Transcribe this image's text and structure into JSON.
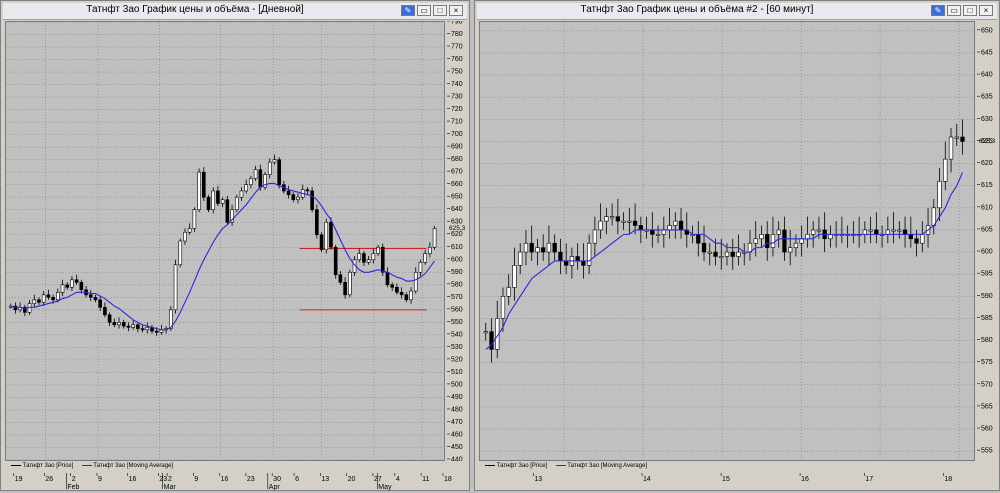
{
  "left_window": {
    "title": "Татнфт 3ао График цены и объёма - [Дневной]",
    "y_ticks": [
      "790",
      "780",
      "770",
      "760",
      "750",
      "740",
      "730",
      "720",
      "710",
      "700",
      "690",
      "680",
      "670",
      "660",
      "650",
      "640",
      "630",
      "620",
      "610",
      "600",
      "590",
      "580",
      "570",
      "560",
      "550",
      "540",
      "530",
      "520",
      "510",
      "500",
      "490",
      "480",
      "470",
      "460",
      "450",
      "440"
    ],
    "last_price_label": "625,3",
    "x_ticks": [
      "19",
      "26",
      "2",
      "9",
      "16",
      "23",
      "2",
      "9",
      "16",
      "23",
      "30",
      "6",
      "13",
      "20",
      "27",
      "4",
      "11",
      "18"
    ],
    "months": [
      "Feb",
      "Mar",
      "Apr",
      "May"
    ],
    "legend_price": "Татнфт 3ао [Price]",
    "legend_ma": "Татнфт 3ао [Moving Average]"
  },
  "right_window": {
    "title": "Татнфт 3ао График цены и объёма #2 - [60 минут]",
    "y_ticks": [
      "650",
      "645",
      "640",
      "635",
      "630",
      "625",
      "620",
      "615",
      "610",
      "605",
      "600",
      "595",
      "590",
      "585",
      "580",
      "575",
      "570",
      "565",
      "560",
      "555"
    ],
    "last_price_label": "625,3",
    "x_ticks": [
      "13",
      "14",
      "15",
      "16",
      "17",
      "18"
    ],
    "legend_price": "Татнфт 3ао [Price]",
    "legend_ma": "Татнфт 3ао [Moving Average]"
  },
  "colors": {
    "candle_up": "#ffffff",
    "candle_down": "#000000",
    "moving_average": "#2a2ad8",
    "level_line": "#d22020",
    "grid": "#808080"
  },
  "chart_data": [
    {
      "type": "candlestick",
      "title": "Татнфт 3ао График цены и объёма - [Дневной]",
      "ylim": [
        440,
        790
      ],
      "series": [
        {
          "name": "Татнфт 3ао [Price]",
          "close": [
            563,
            560,
            562,
            558,
            565,
            568,
            566,
            572,
            570,
            568,
            574,
            580,
            578,
            584,
            582,
            576,
            572,
            570,
            568,
            562,
            556,
            550,
            548,
            550,
            547,
            546,
            548,
            545,
            544,
            546,
            543,
            542,
            544,
            545,
            560,
            596,
            615,
            622,
            625,
            640,
            670,
            650,
            640,
            655,
            645,
            648,
            630,
            640,
            650,
            655,
            660,
            665,
            672,
            658,
            668,
            678,
            680,
            660,
            655,
            652,
            648,
            650,
            656,
            655,
            640,
            620,
            608,
            630,
            610,
            588,
            582,
            572,
            590,
            600,
            605,
            598,
            600,
            605,
            610,
            590,
            580,
            578,
            574,
            572,
            568,
            575,
            590,
            598,
            605,
            610,
            625
          ],
          "style": "black/white candlesticks"
        },
        {
          "name": "Татнфт 3ао [Moving Average]",
          "values": [
            563,
            562,
            562,
            561,
            562,
            562,
            563,
            564,
            565,
            566,
            567,
            569,
            570,
            572,
            574,
            574,
            574,
            573,
            573,
            571,
            569,
            566,
            563,
            561,
            558,
            555,
            552,
            550,
            548,
            547,
            546,
            545,
            544,
            544,
            546,
            551,
            558,
            566,
            574,
            583,
            592,
            600,
            607,
            614,
            620,
            625,
            628,
            632,
            636,
            640,
            644,
            649,
            654,
            658,
            660,
            661,
            661,
            659,
            658,
            656,
            655,
            654,
            653,
            652,
            651,
            648,
            643,
            637,
            632,
            624,
            616,
            608,
            601,
            596,
            592,
            590,
            590,
            591,
            592,
            591,
            590,
            588,
            586,
            585,
            583,
            583,
            584,
            586,
            589,
            594,
            599
          ]
        }
      ],
      "annotations": [
        {
          "type": "horizontal_line",
          "y": 609,
          "color": "#d22020"
        },
        {
          "type": "horizontal_line",
          "y": 560,
          "color": "#d22020"
        }
      ]
    },
    {
      "type": "candlestick",
      "title": "Татнфт 3ао График цены и объёма #2 - [60 минут]",
      "ylim": [
        553,
        652
      ],
      "series": [
        {
          "name": "Татнфт 3ао [Price]",
          "close": [
            582,
            578,
            585,
            590,
            592,
            597,
            600,
            602,
            600,
            601,
            600,
            602,
            600,
            598,
            597,
            599,
            598,
            597,
            602,
            605,
            607,
            608,
            608,
            607,
            607,
            607,
            606,
            605,
            605,
            604,
            604,
            605,
            606,
            607,
            605,
            604,
            604,
            602,
            600,
            600,
            599,
            599,
            600,
            599,
            600,
            600,
            602,
            603,
            604,
            601,
            604,
            605,
            600,
            601,
            602,
            603,
            604,
            605,
            605,
            603,
            604,
            604,
            604,
            604,
            604,
            604,
            605,
            605,
            604,
            604,
            605,
            605,
            605,
            604,
            603,
            602,
            604,
            606,
            610,
            616,
            621,
            626,
            626,
            625
          ],
          "style": "black/white candlesticks"
        },
        {
          "name": "Татнфт 3ао [Moving Average]",
          "values": [
            578,
            579,
            581,
            583,
            586,
            588,
            590,
            592,
            594,
            595,
            596,
            597,
            598,
            598,
            598,
            598,
            598,
            598,
            598,
            599,
            600,
            601,
            602,
            603,
            604,
            604,
            605,
            605,
            605,
            605,
            605,
            605,
            605,
            605,
            605,
            605,
            604,
            604,
            604,
            603,
            602,
            602,
            601,
            601,
            601,
            600,
            600,
            601,
            601,
            602,
            602,
            603,
            603,
            603,
            603,
            603,
            603,
            603,
            604,
            604,
            604,
            604,
            604,
            604,
            604,
            604,
            604,
            604,
            604,
            604,
            604,
            604,
            604,
            604,
            604,
            604,
            604,
            605,
            606,
            608,
            610,
            613,
            615,
            618
          ]
        }
      ]
    }
  ]
}
